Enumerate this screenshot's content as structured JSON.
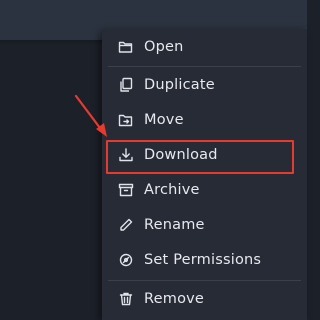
{
  "menu": {
    "items": [
      {
        "label": "Open",
        "icon": "folder-open-icon"
      },
      {
        "label": "Duplicate",
        "icon": "duplicate-icon"
      },
      {
        "label": "Move",
        "icon": "move-folder-icon"
      },
      {
        "label": "Download",
        "icon": "download-icon"
      },
      {
        "label": "Archive",
        "icon": "archive-icon"
      },
      {
        "label": "Rename",
        "icon": "pencil-icon"
      },
      {
        "label": "Set Permissions",
        "icon": "permissions-icon"
      },
      {
        "label": "Remove",
        "icon": "trash-icon"
      }
    ]
  },
  "colors": {
    "page_background": "#1c2029",
    "top_bar": "#2b3340",
    "menu_background": "#262b35",
    "menu_text": "#e7e9ee",
    "annotation_red": "#e53a30"
  }
}
